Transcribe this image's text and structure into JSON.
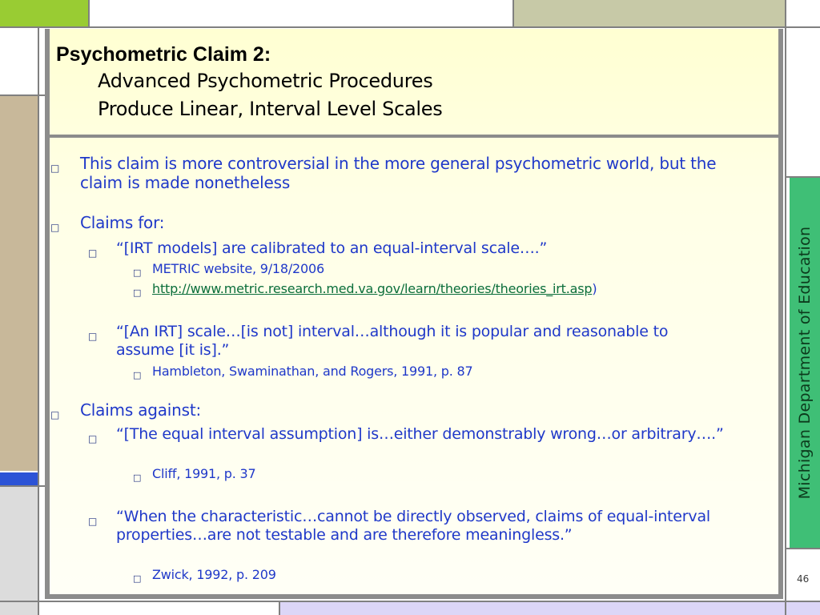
{
  "title": {
    "heading": "Psychometric Claim 2:",
    "line2": "Advanced Psychometric Procedures",
    "line3": "Produce Linear, Interval Level Scales"
  },
  "content": {
    "p1": "This claim is more controversial in the more general psychometric world, but the claim is made nonetheless",
    "p2": "Claims for:",
    "p2a": "“[IRT models] are calibrated to an equal-interval scale….”",
    "p2a1": "METRIC website, 9/18/2006",
    "p2a2_link": "http://www.metric.research.med.va.gov/learn/theories/theories_irt.asp",
    "p2a2_tail": ")",
    "p2b": "“[An IRT] scale…[is not] interval…although it is popular and reasonable to assume [it is].”",
    "p2b1": "Hambleton, Swaminathan, and Rogers, 1991, p. 87",
    "p3": "Claims against:",
    "p3a": "“[The equal interval assumption] is…either demonstrably wrong…or arbitrary….”",
    "p3a1": "Cliff, 1991, p. 37",
    "p3b": "“When the characteristic…cannot be directly observed, claims of equal-interval properties…are not testable and are therefore meaningless.”",
    "p3b1": "Zwick, 1992, p. 209"
  },
  "bullet_glyph": "□",
  "sidebar_label": "Michigan Department of Education",
  "page_number": "46",
  "colors": {
    "text_blue": "#1f38c9",
    "link_green": "#0b6e3b",
    "sidebar_green": "#3fbf76",
    "top_green": "#99cc33",
    "tan": "#c8b89a",
    "olive_gray": "#c7c9a7",
    "blue_band": "#2c53d6",
    "lavender": "#dcd6f7"
  }
}
